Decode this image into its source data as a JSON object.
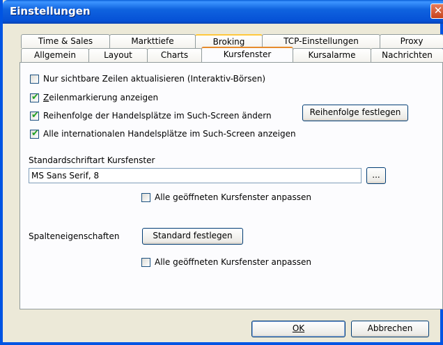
{
  "window": {
    "title": "Einstellungen",
    "close_glyph": "✕"
  },
  "tabs_back": [
    "Time & Sales",
    "Markttiefe",
    "Broking",
    "TCP-Einstellungen",
    "Proxy"
  ],
  "tabs_front": [
    "Allgemein",
    "Layout",
    "Charts",
    "Kursfenster",
    "Kursalarme",
    "Nachrichten"
  ],
  "active_tab": "Kursfenster",
  "options": {
    "opt1": {
      "label": "Nur sichtbare Zeilen aktualisieren (Interaktiv-Börsen)",
      "checked": false
    },
    "opt2": {
      "label": "Zeilenmarkierung anzeigen",
      "checked": true
    },
    "opt3": {
      "label": "Reihenfolge der Handelsplätze im Such-Screen ändern",
      "checked": true
    },
    "opt4": {
      "label": "Alle internationalen Handelsplätze im Such-Screen anzeigen",
      "checked": true
    }
  },
  "reihenfolge_button": "Reihenfolge festlegen",
  "font_section": {
    "label": "Standardschriftart Kursfenster",
    "value": "MS Sans Serif, 8",
    "browse_button": "...",
    "adjust_all": {
      "label": "Alle geöffneten Kursfenster anpassen",
      "checked": false
    }
  },
  "column_section": {
    "label": "Spalteneigenschaften",
    "button": "Standard festlegen",
    "adjust_all": {
      "label": "Alle geöffneten Kursfenster anpassen",
      "checked": false
    }
  },
  "footer": {
    "ok": "OK",
    "cancel": "Abbrechen"
  },
  "colors": {
    "titlebar": "#0054e3",
    "active_tab_accent": "#e68b2c",
    "hover_tab_accent": "#ffc83c",
    "check": "#21a121"
  }
}
